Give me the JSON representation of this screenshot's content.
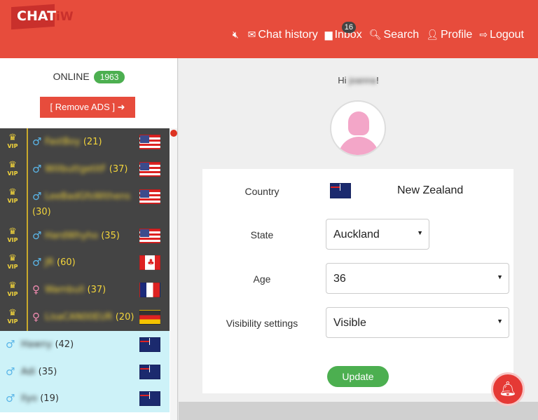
{
  "header": {
    "logo": "CHATIW",
    "nav": [
      {
        "icon": "mute-icon",
        "label": ""
      },
      {
        "icon": "envelope-icon",
        "label": "Chat history"
      },
      {
        "icon": "comment-icon",
        "label": "Inbox",
        "badge": "16"
      },
      {
        "icon": "search-icon",
        "label": "Search"
      },
      {
        "icon": "user-icon",
        "label": "Profile"
      },
      {
        "icon": "logout-icon",
        "label": "Logout"
      }
    ]
  },
  "sidebar": {
    "online_label": "ONLINE",
    "online_count": "1963",
    "remove_ads": "[ Remove ADS ]",
    "users": [
      {
        "vip": true,
        "gender": "male",
        "name": "FastBoy",
        "age": "(21)",
        "flag": "us"
      },
      {
        "vip": true,
        "gender": "male",
        "name": "WillbuttgetitF",
        "age": "(37)",
        "flag": "us"
      },
      {
        "vip": true,
        "gender": "male",
        "name": "LeeBadGfsWithens",
        "age": "(30)",
        "flag": "us"
      },
      {
        "vip": true,
        "gender": "male",
        "name": "HardWhyho",
        "age": "(35)",
        "flag": "us"
      },
      {
        "vip": true,
        "gender": "male",
        "name": "JR",
        "age": "(60)",
        "flag": "ca"
      },
      {
        "vip": true,
        "gender": "female",
        "name": "Wambull",
        "age": "(37)",
        "flag": "fr"
      },
      {
        "vip": true,
        "gender": "female",
        "name": "LisaCAN00EUR",
        "age": "(20)",
        "flag": "de"
      },
      {
        "vip": false,
        "gender": "male",
        "name": "Hawny",
        "age": "(42)",
        "flag": "nz"
      },
      {
        "vip": false,
        "gender": "male",
        "name": "Adi",
        "age": "(35)",
        "flag": "nz"
      },
      {
        "vip": false,
        "gender": "male",
        "name": "Ilyo",
        "age": "(19)",
        "flag": "nz"
      }
    ],
    "vip_label": "VIP"
  },
  "profile": {
    "greeting_pre": "Hi",
    "username": "joanna",
    "greeting_post": "!",
    "country_label": "Country",
    "country": "New Zealand",
    "state_label": "State",
    "state": "Auckland",
    "age_label": "Age",
    "age": "36",
    "visibility_label": "Visibility settings",
    "visibility": "Visible",
    "update": "Update"
  },
  "colors": {
    "header": "#e74c3c",
    "vip_bg": "#444444",
    "vip_text": "#f2d43b",
    "nz_bg": "#cdf2f8",
    "update": "#4caf50"
  }
}
